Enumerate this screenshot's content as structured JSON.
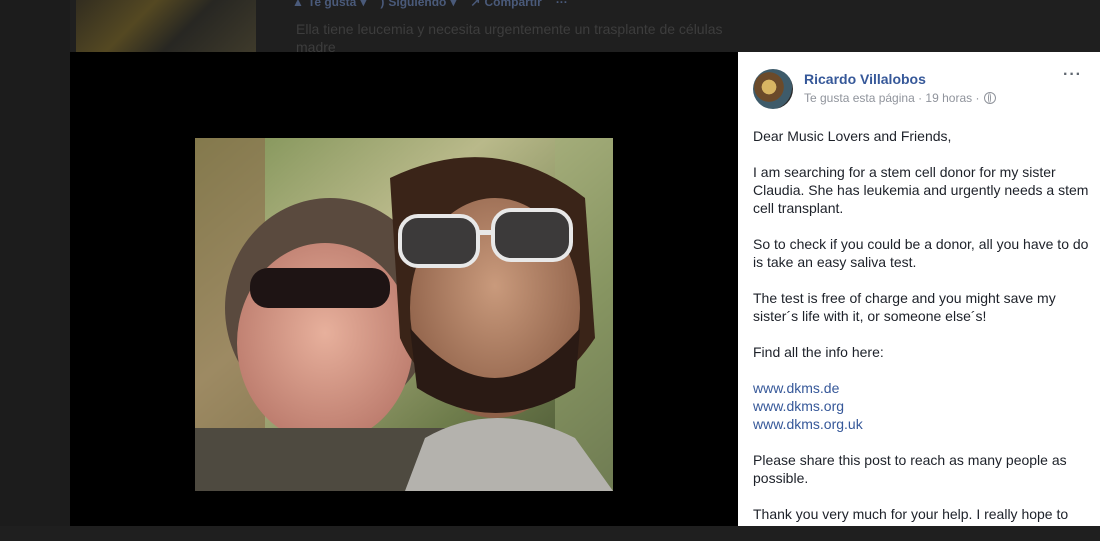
{
  "background_feed": {
    "actions": [
      {
        "icon": "like-icon",
        "label": "Te gusta",
        "dropdown": true
      },
      {
        "icon": "rss-icon",
        "label": "Siguiendo",
        "dropdown": true
      },
      {
        "icon": "share-icon",
        "label": "Compartir",
        "dropdown": false
      }
    ],
    "more_label": "···",
    "text": "Ella tiene leucemia y necesita urgentemente un trasplante de células madre"
  },
  "post": {
    "author": "Ricardo Villalobos",
    "meta": "Te gusta esta página · 19 horas ·",
    "audience_icon": "globe-icon",
    "more_label": "···",
    "greeting": "Dear Music Lovers and Friends,",
    "para1": "I am searching for a stem cell donor for my sister Claudia. She has leukemia and urgently needs a stem cell transplant.",
    "para2": "So to check if you could be a donor, all you have to do is take an easy saliva test.",
    "para3": "The test is free of charge and you might save my sister´s life with it, or someone else´s!",
    "para4": "Find all the info here:",
    "links": [
      "www.dkms.de",
      "www.dkms.org",
      "www.dkms.org.uk"
    ],
    "para5": "Please share this post to reach as many people as possible.",
    "para6": "Thank you very much for your help. I really hope to"
  }
}
